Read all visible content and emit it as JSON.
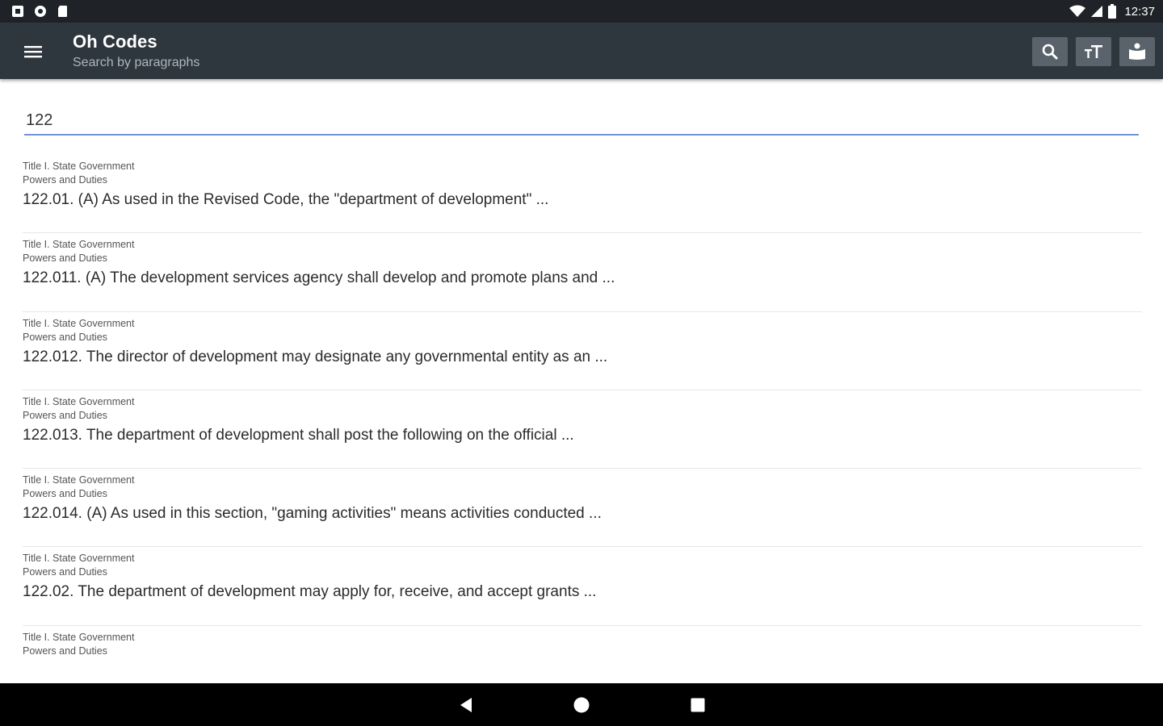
{
  "status_bar": {
    "left_icons": [
      "notification-a-icon",
      "notification-b-icon",
      "sd-card-icon"
    ],
    "right_icons": [
      "wifi-icon",
      "cell-signal-icon",
      "battery-icon"
    ],
    "time": "12:37"
  },
  "app_bar": {
    "title": "Oh Codes",
    "subtitle": "Search by paragraphs",
    "actions": [
      "search-icon",
      "text-size-icon",
      "reader-icon"
    ]
  },
  "search": {
    "value": "122",
    "placeholder": ""
  },
  "results": [
    {
      "title": "Title I. State Government",
      "chapter": "Powers and Duties",
      "text": "122.01. (A) As used in the Revised Code, the \"department of development\" ..."
    },
    {
      "title": "Title I. State Government",
      "chapter": "Powers and Duties",
      "text": "122.011. (A) The development services agency shall develop and promote plans and ..."
    },
    {
      "title": "Title I. State Government",
      "chapter": "Powers and Duties",
      "text": "122.012. The director of development may designate any governmental entity as an ..."
    },
    {
      "title": "Title I. State Government",
      "chapter": "Powers and Duties",
      "text": "122.013. The department of development shall post the following on the official ..."
    },
    {
      "title": "Title I. State Government",
      "chapter": "Powers and Duties",
      "text": "122.014. (A) As used in this section, \"gaming activities\" means activities conducted ..."
    },
    {
      "title": "Title I. State Government",
      "chapter": "Powers and Duties",
      "text": "122.02. The department of development may apply for, receive, and accept grants ..."
    },
    {
      "title": "Title I. State Government",
      "chapter": "Powers and Duties",
      "text": ""
    }
  ],
  "nav_bar": {
    "buttons": [
      "back-icon",
      "home-icon",
      "recents-icon"
    ]
  },
  "colors": {
    "app_bar": "#2f373e",
    "status_bar": "#1f2327",
    "accent_underline": "#6f95d6"
  }
}
